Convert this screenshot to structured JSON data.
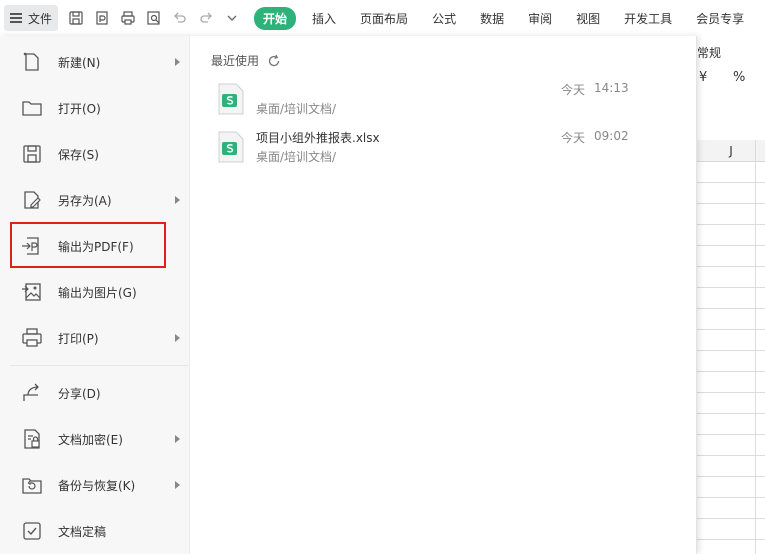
{
  "toolbar": {
    "file_label": "文件",
    "quick_icons": [
      "save-icon",
      "export-pdf-icon",
      "print-icon",
      "print-preview-icon",
      "undo-icon",
      "redo-icon",
      "customize-chevron-icon"
    ],
    "tabs": [
      {
        "label": "开始",
        "active": true
      },
      {
        "label": "插入",
        "active": false
      },
      {
        "label": "页面布局",
        "active": false
      },
      {
        "label": "公式",
        "active": false
      },
      {
        "label": "数据",
        "active": false
      },
      {
        "label": "审阅",
        "active": false
      },
      {
        "label": "视图",
        "active": false
      },
      {
        "label": "开发工具",
        "active": false
      },
      {
        "label": "会员专享",
        "active": false
      }
    ],
    "accent_color": "#2db37a"
  },
  "ribbon": {
    "number_format": "常规",
    "currency_symbol": "¥",
    "percent_symbol": "%"
  },
  "sheet": {
    "column_header": "J"
  },
  "menu": {
    "items": [
      {
        "label": "新建(N)",
        "icon": "new-file-icon",
        "has_submenu": true
      },
      {
        "label": "打开(O)",
        "icon": "open-folder-icon",
        "has_submenu": false
      },
      {
        "label": "保存(S)",
        "icon": "save-icon",
        "has_submenu": false
      },
      {
        "label": "另存为(A)",
        "icon": "save-as-icon",
        "has_submenu": true
      },
      {
        "label": "输出为PDF(F)",
        "icon": "export-pdf-icon",
        "has_submenu": false,
        "highlighted": true
      },
      {
        "label": "输出为图片(G)",
        "icon": "export-image-icon",
        "has_submenu": false
      },
      {
        "label": "打印(P)",
        "icon": "print-icon",
        "has_submenu": true
      },
      {
        "label": "分享(D)",
        "icon": "share-icon",
        "has_submenu": false
      },
      {
        "label": "文档加密(E)",
        "icon": "encrypt-icon",
        "has_submenu": true
      },
      {
        "label": "备份与恢复(K)",
        "icon": "backup-icon",
        "has_submenu": true
      },
      {
        "label": "文档定稿",
        "icon": "finalize-icon",
        "has_submenu": false
      }
    ],
    "highlight_color": "#e02020"
  },
  "recent": {
    "title": "最近使用",
    "files": [
      {
        "name": "",
        "path": "桌面/培训文档/",
        "day": "今天",
        "time": "14:13"
      },
      {
        "name": "项目小组外推报表.xlsx",
        "path": "桌面/培训文档/",
        "day": "今天",
        "time": "09:02"
      }
    ],
    "file_icon_color": "#2db37a"
  }
}
